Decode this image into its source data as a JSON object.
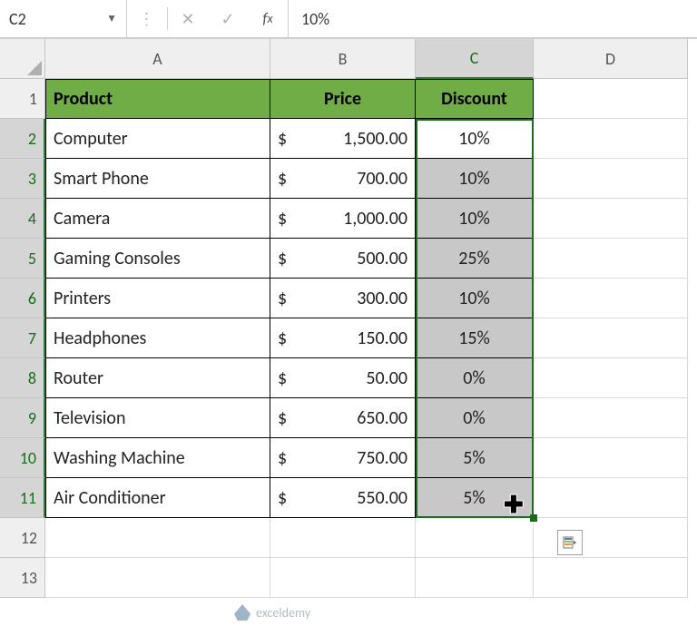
{
  "nameBox": "C2",
  "formulaValue": "10%",
  "columns": [
    "A",
    "B",
    "C",
    "D"
  ],
  "rowNums": [
    "1",
    "2",
    "3",
    "4",
    "5",
    "6",
    "7",
    "8",
    "9",
    "10",
    "11",
    "12",
    "13"
  ],
  "headers": {
    "a": "Product",
    "b": "Price",
    "c": "Discount"
  },
  "rows": [
    {
      "product": "Computer",
      "price": "1,500.00",
      "discount": "10%"
    },
    {
      "product": "Smart Phone",
      "price": "700.00",
      "discount": "10%"
    },
    {
      "product": "Camera",
      "price": "1,000.00",
      "discount": "10%"
    },
    {
      "product": "Gaming Consoles",
      "price": "500.00",
      "discount": "25%"
    },
    {
      "product": "Printers",
      "price": "300.00",
      "discount": "10%"
    },
    {
      "product": "Headphones",
      "price": "150.00",
      "discount": "15%"
    },
    {
      "product": "Router",
      "price": "50.00",
      "discount": "0%"
    },
    {
      "product": "Television",
      "price": "650.00",
      "discount": "0%"
    },
    {
      "product": "Washing Machine",
      "price": "750.00",
      "discount": "5%"
    },
    {
      "product": "Air Conditioner",
      "price": "550.00",
      "discount": "5%"
    }
  ],
  "watermark": "exceldemy",
  "chart_data": {
    "type": "table",
    "title": "Product Prices and Discounts",
    "columns": [
      "Product",
      "Price",
      "Discount"
    ],
    "data": [
      [
        "Computer",
        1500.0,
        0.1
      ],
      [
        "Smart Phone",
        700.0,
        0.1
      ],
      [
        "Camera",
        1000.0,
        0.1
      ],
      [
        "Gaming Consoles",
        500.0,
        0.25
      ],
      [
        "Printers",
        300.0,
        0.1
      ],
      [
        "Headphones",
        150.0,
        0.15
      ],
      [
        "Router",
        50.0,
        0.0
      ],
      [
        "Television",
        650.0,
        0.0
      ],
      [
        "Washing Machine",
        750.0,
        0.05
      ],
      [
        "Air Conditioner",
        550.0,
        0.05
      ]
    ]
  }
}
